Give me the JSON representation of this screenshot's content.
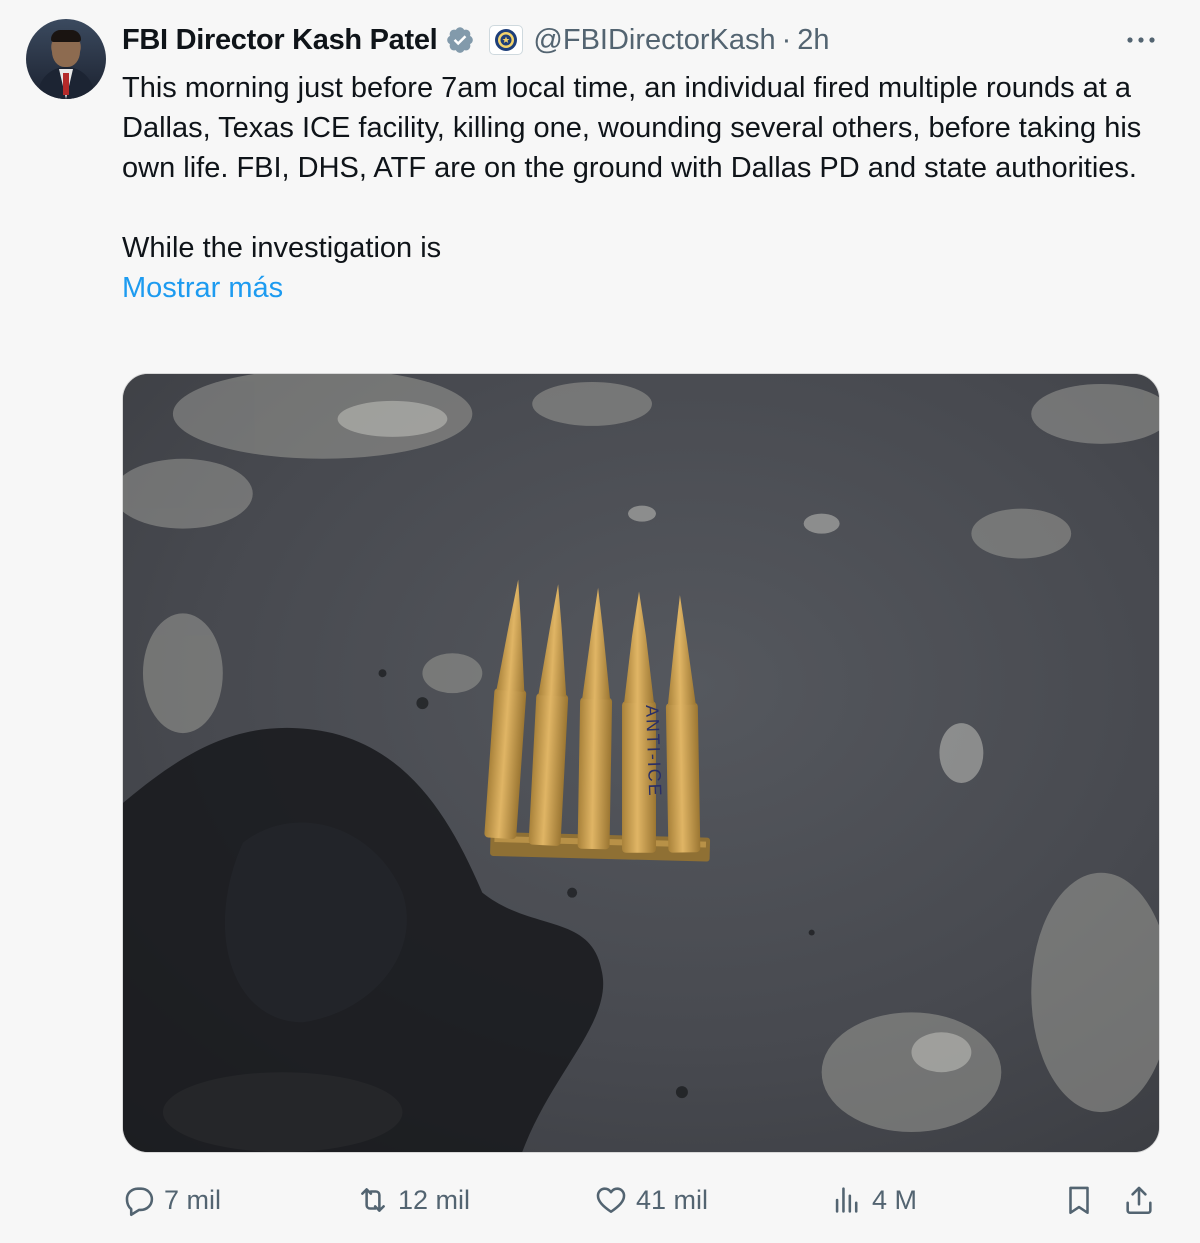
{
  "author": {
    "display_name": "FBI Director Kash Patel",
    "handle": "@FBIDirectorKash",
    "separator": "·",
    "time": "2h"
  },
  "icons": {
    "verified": "verified-badge-icon",
    "org_badge": "fbi-seal-icon",
    "more": "more-options-icon"
  },
  "tweet": {
    "paragraph_1": "This morning just before 7am local time, an individual fired multiple rounds at a Dallas, Texas ICE facility, killing one, wounding several others, before taking his own life. FBI, DHS, ATF are on the ground with Dallas PD and state authorities.",
    "paragraph_2": "While the investigation is",
    "show_more": "Mostrar más"
  },
  "media": {
    "cartridge_inscription": "ANTI-ICE"
  },
  "actions": {
    "replies": "7 mil",
    "reposts": "12 mil",
    "likes": "41 mil",
    "views": "4 M"
  },
  "colors": {
    "link": "#1d9bf0",
    "secondary_text": "#536471",
    "verified": "#829aab"
  }
}
